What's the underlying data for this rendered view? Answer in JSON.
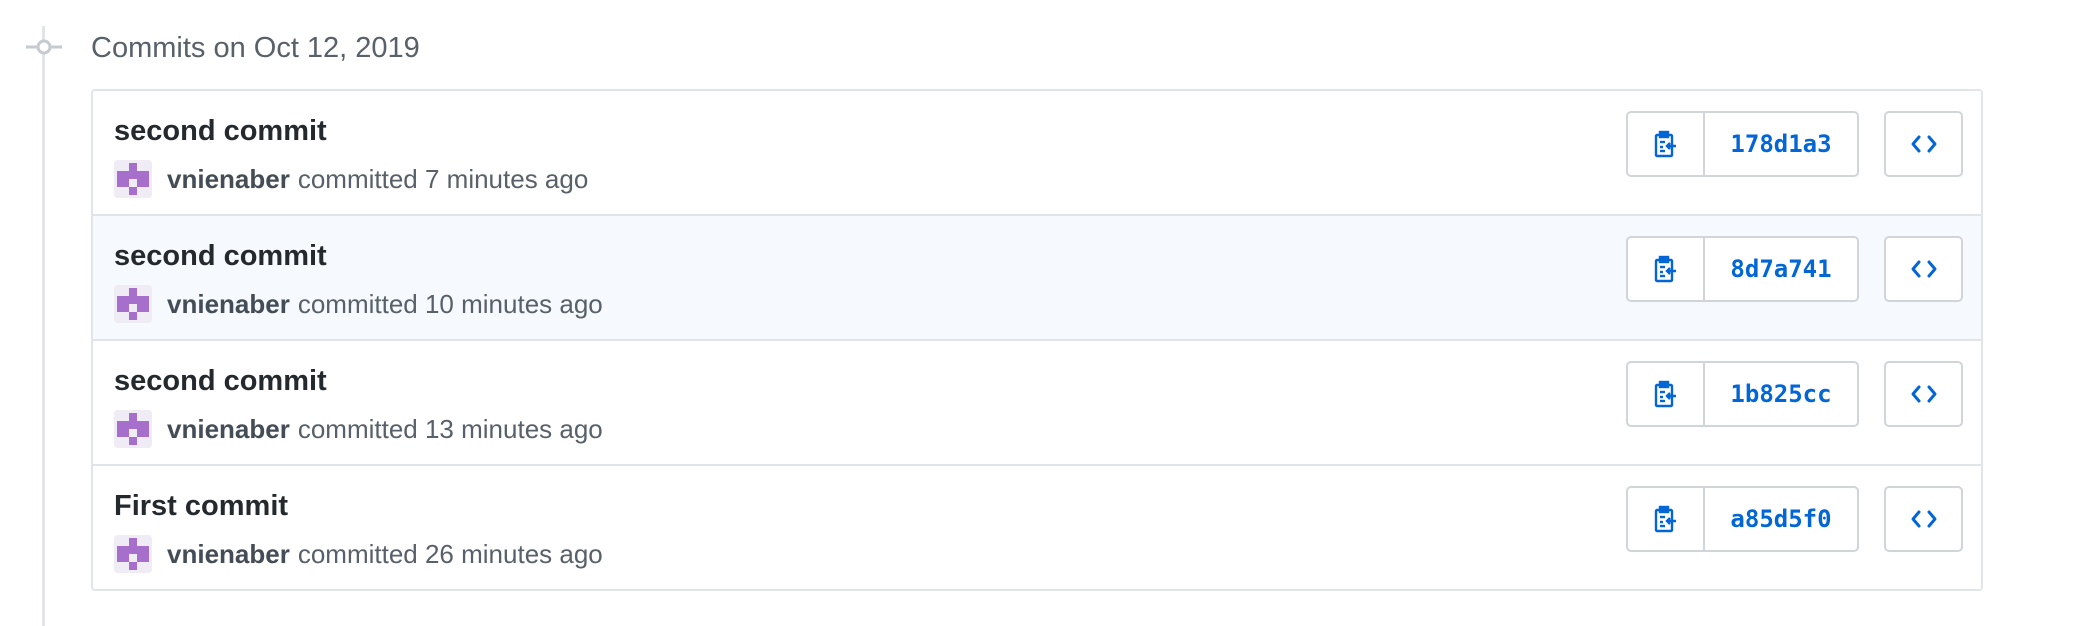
{
  "group": {
    "date_label": "Commits on Oct 12, 2019"
  },
  "commits": [
    {
      "title": "second commit",
      "author": "vnienaber",
      "committed_text": "committed 7 minutes ago",
      "sha": "178d1a3",
      "highlighted": false
    },
    {
      "title": "second commit",
      "author": "vnienaber",
      "committed_text": "committed 10 minutes ago",
      "sha": "8d7a741",
      "highlighted": true
    },
    {
      "title": "second commit",
      "author": "vnienaber",
      "committed_text": "committed 13 minutes ago",
      "sha": "1b825cc",
      "highlighted": false
    },
    {
      "title": "First commit",
      "author": "vnienaber",
      "committed_text": "committed 26 minutes ago",
      "sha": "a85d5f0",
      "highlighted": false
    }
  ],
  "icons": {
    "timeline": "git-commit-icon",
    "copy": "clippy-icon",
    "browse": "code-icon",
    "avatar": "identicon-avatar"
  },
  "colors": {
    "link_blue": "#0366d6",
    "avatar_purple": "#a66fcc",
    "highlight_row": "#f6f9fd",
    "border": "#e1e4e8"
  }
}
